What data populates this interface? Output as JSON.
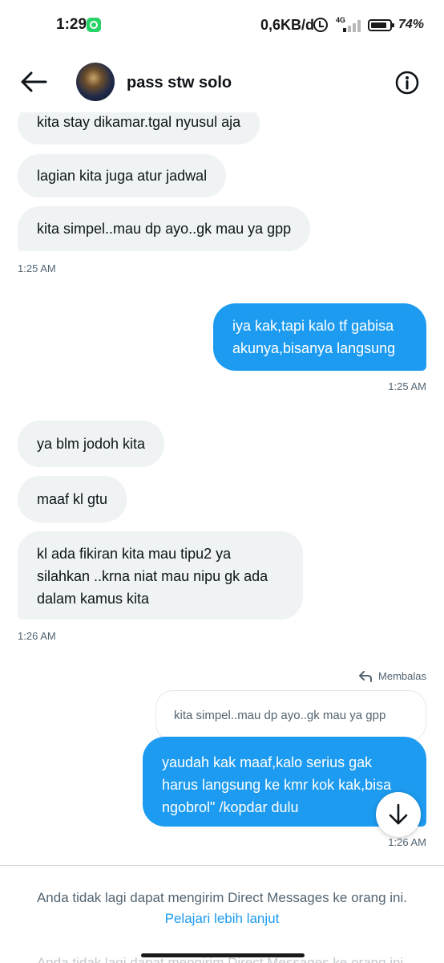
{
  "status_bar": {
    "time": "1:29",
    "network_speed": "0,6KB/d",
    "network_type": "4G",
    "battery_percent": "74%",
    "notification_icons": [
      "whatsapp-icon"
    ]
  },
  "header": {
    "contact_name": "pass stw solo",
    "back_icon": "arrow-left-icon",
    "info_icon": "info-icon"
  },
  "messages": [
    {
      "from": "them",
      "text": "kita stay dikamar.tgal nyusul aja"
    },
    {
      "from": "them",
      "text": "lagian kita juga atur jadwal"
    },
    {
      "from": "them",
      "text": "kita simpel..mau dp ayo..gk mau ya gpp"
    },
    {
      "time": "1:25 AM"
    },
    {
      "from": "me",
      "lines": [
        "iya kak,tapi kalo tf gabisa",
        "akunya,bisanya langsung"
      ]
    },
    {
      "time": "1:25 AM"
    },
    {
      "from": "them",
      "text": "ya blm jodoh kita"
    },
    {
      "from": "them",
      "text": "maaf kl gtu"
    },
    {
      "from": "them",
      "lines": [
        "kl ada fikiran kita mau tipu2 ya",
        "silahkan ..krna niat mau nipu gk ada",
        "dalam kamus kita"
      ]
    },
    {
      "time": "1:26 AM"
    },
    {
      "reply_label": "Membalas",
      "quoted": "kita simpel..mau dp ayo..gk mau ya gpp"
    },
    {
      "from": "me",
      "lines": [
        "yaudah kak maaf,kalo serius gak",
        "harus langsung ke kmr kok kak,bisa",
        "ngobrol\" /kopdar dulu"
      ]
    },
    {
      "time": "1:26 AM"
    }
  ],
  "footer": {
    "notice": "Anda tidak lagi dapat mengirim Direct Messages ke orang ini.",
    "learn_more": "Pelajari lebih lanjut"
  },
  "colors": {
    "outgoing_bubble": "#1d9bf0",
    "incoming_bubble": "#eff3f4",
    "link": "#1d9bf0",
    "muted_text": "#536471"
  }
}
